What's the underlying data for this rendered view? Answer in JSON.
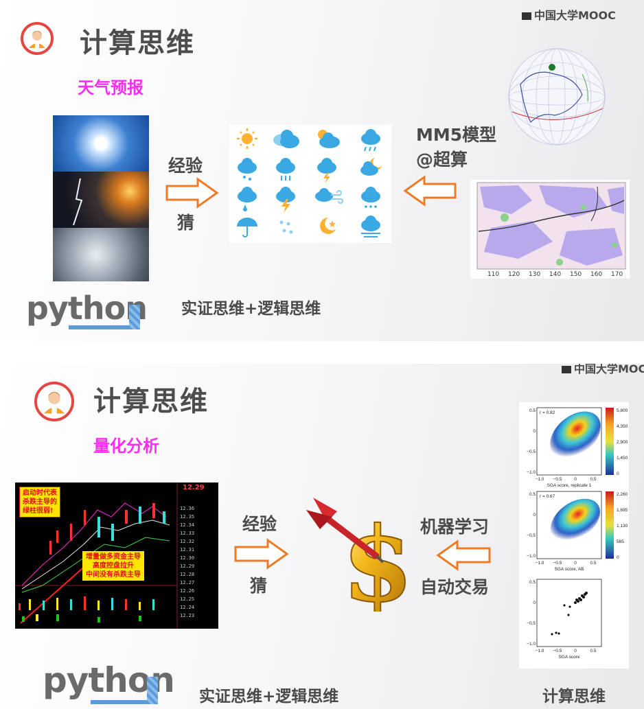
{
  "brand": "中国大学MOOC",
  "brand_partial": "中国大学MOC",
  "colors": {
    "arrow": "#ee7a26",
    "subtitle": "#ff2cf5",
    "ring": "#e64540",
    "title": "#4d4d4d"
  },
  "slide1": {
    "title": "计算思维",
    "subtitle": "天气预报",
    "left_top": "经验",
    "left_bottom": "猜",
    "right_top": "MM5模型",
    "right_bottom": "@超算",
    "caption": "实证思维+逻辑思维",
    "python": "python",
    "weather_icons": [
      "sun",
      "cloud",
      "sun-cloud",
      "rain-cloud",
      "rain-cloud",
      "rain-cloud",
      "storm-cloud",
      "moon-cloud",
      "rain-cloud",
      "lightning",
      "wind-cloud",
      "snow-cloud",
      "umbrella",
      "drops",
      "moon-star",
      "fog-cloud"
    ]
  },
  "slide2": {
    "title": "计算思维",
    "subtitle": "量化分析",
    "left_top": "经验",
    "left_bottom": "猜",
    "right_top": "机器学习",
    "right_bottom": "自动交易",
    "caption": "实证思维+逻辑思维",
    "caption_right": "计算思维",
    "python": "python",
    "stock_note1": [
      "启动时代表",
      "杀跌主导的",
      "绿柱很弱!"
    ],
    "stock_note2": [
      "增量做多资金主导",
      "高度控盘拉升",
      "中间没有杀跌主导"
    ],
    "stock_price": "12.29",
    "plots": [
      {
        "r": "r = 0.82",
        "xlabel": "SGA score, replicate 1",
        "scale": [
          "5,800",
          "4,350",
          "2,900",
          "1,450",
          "0"
        ]
      },
      {
        "r": "r = 0.67",
        "xlabel": "SGA score, AB",
        "scale": [
          "2,260",
          "1,695",
          "1,130",
          "565",
          "0"
        ]
      },
      {
        "r": "",
        "xlabel": "SGA score",
        "scale": []
      }
    ],
    "yticks": [
      "0.5",
      "0",
      "−0.5",
      "−1.0"
    ],
    "xticks": [
      "−1.0",
      "−0.5",
      "0",
      "0.5"
    ]
  }
}
